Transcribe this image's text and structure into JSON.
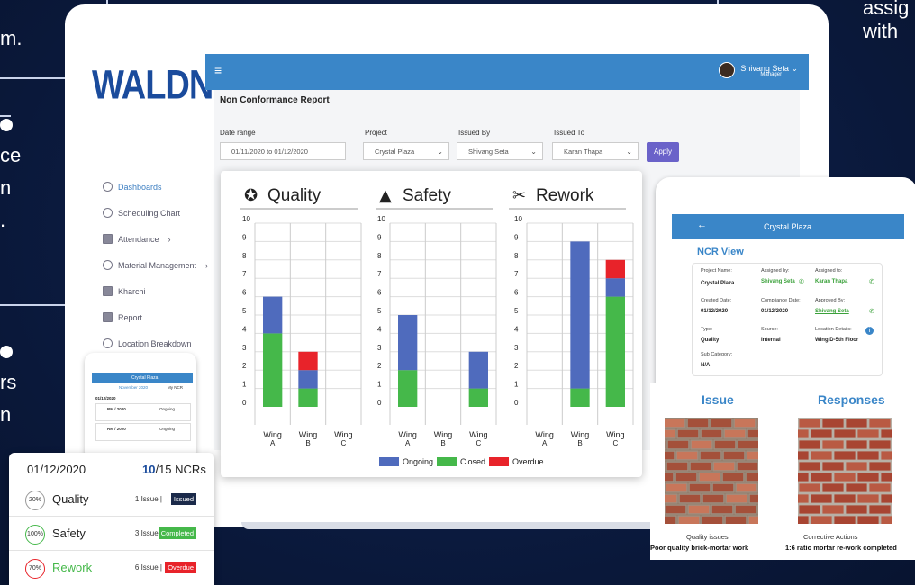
{
  "edge_text": {
    "top_left": "m.",
    "left_1_a": "ce",
    "left_1_b": "n",
    "left_1_c": ".",
    "left_2_a": "rs",
    "left_2_b": "n",
    "top_right_1": "assig",
    "top_right_2": "with"
  },
  "app": {
    "logo": "WALDNER",
    "sidebar": [
      {
        "label": "Dashboards",
        "icon": "dashboard-icon",
        "active": true
      },
      {
        "label": "Scheduling Chart",
        "icon": "clock-icon"
      },
      {
        "label": "Attendance",
        "icon": "calendar-icon",
        "arrow": "›"
      },
      {
        "label": "Material Management",
        "icon": "warning-icon",
        "arrow": "›"
      },
      {
        "label": "Kharchi",
        "icon": "money-icon"
      },
      {
        "label": "Report",
        "icon": "report-icon"
      },
      {
        "label": "Location Breakdown",
        "icon": "location-icon"
      }
    ],
    "user": {
      "name": "Shivang Seta",
      "role": "Manager",
      "caret": "⌄"
    },
    "menu_glyph": "≡",
    "page_title": "Non Conformance Report",
    "filters": {
      "date_label": "Date range",
      "date_value": "01/11/2020 to 01/12/2020",
      "project_label": "Project",
      "project_value": "Crystal Plaza",
      "issued_by_label": "Issued By",
      "issued_by_value": "Shivang Seta",
      "issued_to_label": "Issued To",
      "issued_to_value": "Karan Thapa",
      "apply": "Apply"
    }
  },
  "colors": {
    "ongoing": "#4f6bbd",
    "closed": "#45b84a",
    "overdue": "#e8232a",
    "primary": "#3a86c8"
  },
  "chart_data": [
    {
      "type": "bar",
      "title": "Quality",
      "icon": "award-icon",
      "categories": [
        "Wing A",
        "Wing B",
        "Wing C"
      ],
      "ylim": [
        0,
        10
      ],
      "yticks": [
        0,
        1,
        2,
        3,
        4,
        5,
        6,
        7,
        8,
        9,
        10
      ],
      "stacked": true,
      "series": [
        {
          "name": "Ongoing",
          "values": [
            2,
            1,
            0
          ]
        },
        {
          "name": "Closed",
          "values": [
            4,
            1,
            0
          ]
        },
        {
          "name": "Overdue",
          "values": [
            0,
            1,
            0
          ]
        }
      ]
    },
    {
      "type": "bar",
      "title": "Safety",
      "icon": "cone-icon",
      "categories": [
        "Wing A",
        "Wing B",
        "Wing C"
      ],
      "ylim": [
        0,
        10
      ],
      "yticks": [
        0,
        1,
        2,
        3,
        4,
        5,
        6,
        7,
        8,
        9,
        10
      ],
      "stacked": true,
      "series": [
        {
          "name": "Ongoing",
          "values": [
            3,
            0,
            2
          ]
        },
        {
          "name": "Closed",
          "values": [
            2,
            0,
            1
          ]
        },
        {
          "name": "Overdue",
          "values": [
            0,
            0,
            0
          ]
        }
      ]
    },
    {
      "type": "bar",
      "title": "Rework",
      "icon": "tools-icon",
      "categories": [
        "Wing A",
        "Wing B",
        "Wing C"
      ],
      "ylim": [
        0,
        10
      ],
      "yticks": [
        0,
        1,
        2,
        3,
        4,
        5,
        6,
        7,
        8,
        9,
        10
      ],
      "stacked": true,
      "series": [
        {
          "name": "Ongoing",
          "values": [
            0,
            8,
            1
          ]
        },
        {
          "name": "Closed",
          "values": [
            0,
            1,
            6
          ]
        },
        {
          "name": "Overdue",
          "values": [
            0,
            0,
            1
          ]
        }
      ]
    }
  ],
  "legend": [
    "Ongoing",
    "Closed",
    "Overdue"
  ],
  "ncr_view": {
    "bar_title": "Crystal Plaza",
    "back": "←",
    "title": "NCR View",
    "fields": [
      {
        "label": "Project Name:",
        "value": "Crystal Plaza"
      },
      {
        "label": "Assigned by:",
        "value": "Shivang Seta"
      },
      {
        "label": "Assigned to:",
        "value": "Karan Thapa"
      },
      {
        "label": "Created Date:",
        "value": "01/12/2020"
      },
      {
        "label": "Compliance Date:",
        "value": "01/12/2020"
      },
      {
        "label": "Approved By:",
        "value": "Shivang Seta"
      },
      {
        "label": "Type:",
        "value": "Quality"
      },
      {
        "label": "Source:",
        "value": "Internal"
      },
      {
        "label": "Location Details:",
        "value": "Wing D-5th Floor"
      },
      {
        "label": "Sub Category:",
        "value": "N/A"
      }
    ]
  },
  "issue_card": {
    "issue_head": "Issue",
    "responses_head": "Responses",
    "issue_caption": "Quality issues",
    "issue_caption_bold": "Poor quality brick-mortar work",
    "response_caption": "Corrective Actions",
    "response_caption_bold": "1:6 ratio mortar re-work completed"
  },
  "phone": {
    "bar_title": "Crystal Plaza",
    "month": "November 2020",
    "filter": "My NCR",
    "date": "01/12/2020",
    "rows": [
      {
        "id": "RM / 2020",
        "status": "Ongoing"
      },
      {
        "id": "RM / 2020",
        "status": "Ongoing"
      }
    ]
  },
  "ncr_summary": {
    "date": "01/12/2020",
    "count_done": "10",
    "count_total": "/15 NCRs",
    "rows": [
      {
        "pct": "20%",
        "label": "Quality",
        "count": "1 Issue |",
        "tag": "Issued",
        "tag_color": "#1b2a4a",
        "label_color": "#222",
        "ring": "#999"
      },
      {
        "pct": "100%",
        "label": "Safety",
        "count": "3 Issue |",
        "tag": "Completed",
        "tag_color": "#45b84a",
        "label_color": "#222",
        "ring": "#45b84a"
      },
      {
        "pct": "70%",
        "label": "Rework",
        "count": "6 Issue |",
        "tag": "Overdue",
        "tag_color": "#e8232a",
        "label_color": "#45b84a",
        "ring": "#e8232a"
      }
    ]
  }
}
